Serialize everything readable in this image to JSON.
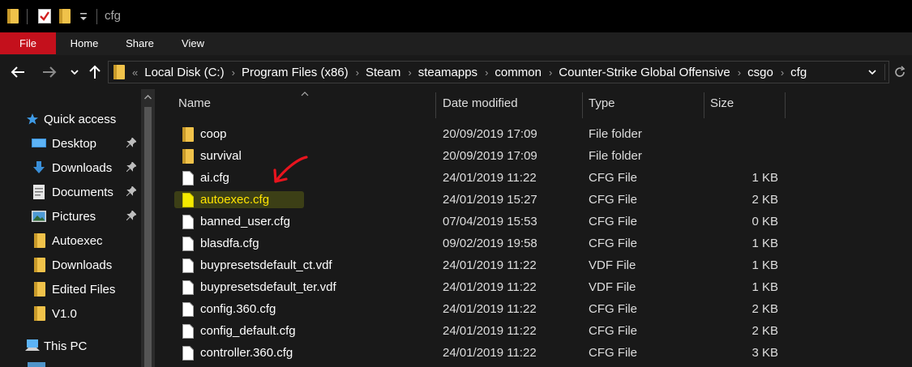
{
  "window": {
    "title": "cfg"
  },
  "ribbon": {
    "tabs": [
      "File",
      "Home",
      "Share",
      "View"
    ],
    "active_color": "#c4101c"
  },
  "breadcrumb": [
    "Local Disk (C:)",
    "Program Files (x86)",
    "Steam",
    "steamapps",
    "common",
    "Counter-Strike Global Offensive",
    "csgo",
    "cfg"
  ],
  "sidebar": {
    "items": [
      {
        "label": "Quick access",
        "icon": "star-icon"
      },
      {
        "label": "Desktop",
        "icon": "desktop-icon",
        "pinned": true
      },
      {
        "label": "Downloads",
        "icon": "download-arrow-icon",
        "pinned": true
      },
      {
        "label": "Documents",
        "icon": "documents-icon",
        "pinned": true
      },
      {
        "label": "Pictures",
        "icon": "pictures-icon",
        "pinned": true
      },
      {
        "label": "Autoexec",
        "icon": "folder-icon"
      },
      {
        "label": "Downloads",
        "icon": "folder-icon"
      },
      {
        "label": "Edited Files",
        "icon": "folder-icon"
      },
      {
        "label": "V1.0",
        "icon": "folder-icon"
      },
      {
        "label": "This PC",
        "icon": "computer-icon"
      }
    ]
  },
  "columns": {
    "name": "Name",
    "date": "Date modified",
    "type": "Type",
    "size": "Size"
  },
  "files": [
    {
      "name": "coop",
      "date": "20/09/2019 17:09",
      "type": "File folder",
      "size": "",
      "kind": "folder"
    },
    {
      "name": "survival",
      "date": "20/09/2019 17:09",
      "type": "File folder",
      "size": "",
      "kind": "folder"
    },
    {
      "name": "ai.cfg",
      "date": "24/01/2019 11:22",
      "type": "CFG File",
      "size": "1 KB",
      "kind": "file"
    },
    {
      "name": "autoexec.cfg",
      "date": "24/01/2019 15:27",
      "type": "CFG File",
      "size": "2 KB",
      "kind": "file",
      "highlighted": true
    },
    {
      "name": "banned_user.cfg",
      "date": "07/04/2019 15:53",
      "type": "CFG File",
      "size": "0 KB",
      "kind": "file"
    },
    {
      "name": "blasdfa.cfg",
      "date": "09/02/2019 19:58",
      "type": "CFG File",
      "size": "1 KB",
      "kind": "file"
    },
    {
      "name": "buypresetsdefault_ct.vdf",
      "date": "24/01/2019 11:22",
      "type": "VDF File",
      "size": "1 KB",
      "kind": "file"
    },
    {
      "name": "buypresetsdefault_ter.vdf",
      "date": "24/01/2019 11:22",
      "type": "VDF File",
      "size": "1 KB",
      "kind": "file"
    },
    {
      "name": "config.360.cfg",
      "date": "24/01/2019 11:22",
      "type": "CFG File",
      "size": "2 KB",
      "kind": "file"
    },
    {
      "name": "config_default.cfg",
      "date": "24/01/2019 11:22",
      "type": "CFG File",
      "size": "2 KB",
      "kind": "file"
    },
    {
      "name": "controller.360.cfg",
      "date": "24/01/2019 11:22",
      "type": "CFG File",
      "size": "3 KB",
      "kind": "file"
    }
  ],
  "colors": {
    "folder": "#f0c24a",
    "highlight_text": "#ffe400",
    "annotation_arrow": "#e8141e"
  }
}
